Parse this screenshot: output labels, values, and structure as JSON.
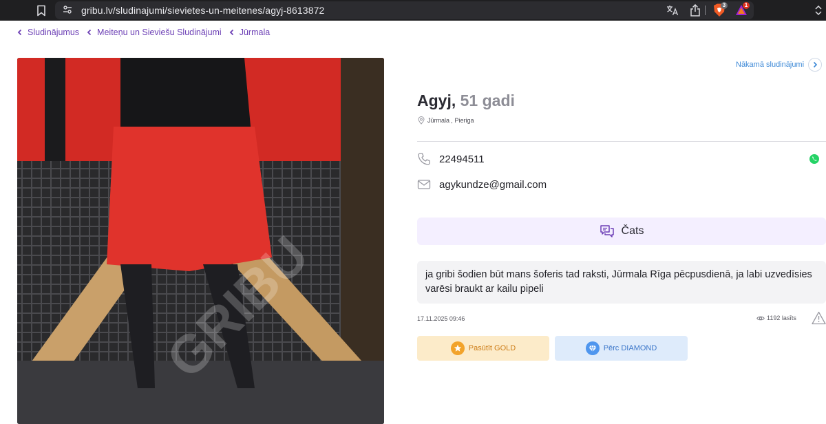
{
  "browser": {
    "url": "gribu.lv/sludinajumi/sievietes-un-meitenes/agyj-8613872",
    "shields_badge": "3",
    "rewards_badge": "1"
  },
  "breadcrumb": [
    {
      "label": "Sludinājumus"
    },
    {
      "label": "Meiteņu un Sieviešu Sludinājumi"
    },
    {
      "label": "Jūrmala"
    }
  ],
  "listing": {
    "next_label": "Nākamā sludinājumi",
    "name": "Agyj,",
    "age": "51 gadi",
    "location_city": "Jūrmala",
    "location_sep": ",",
    "location_region": "Pieriga",
    "phone": "22494511",
    "email": "agykundze@gmail.com",
    "chat_label": "Čats",
    "description": "ja gribi šodien būt mans šoferis tad raksti, Jūrmala Rīga pēcpusdienā, ja labi uzvedīsies varēsi braukt ar kailu pipeli",
    "date": "17.11.2025 09:46",
    "views": "1192 lasīts",
    "gold_label": "Pasūtīt GOLD",
    "diamond_label": "Pērc DIAMOND",
    "watermark": "GRIBU"
  },
  "colors": {
    "accent_purple": "#6c3fb5",
    "link_blue": "#3a87d6",
    "gold": "#f2a32a",
    "diamond": "#4f96ee",
    "whatsapp": "#25d366"
  },
  "icons": [
    "bookmark-icon",
    "site-settings-icon",
    "translate-icon",
    "share-icon",
    "brave-shields-icon",
    "brave-rewards-icon",
    "sidepanel-icon",
    "chevron-left-icon",
    "chevron-right-icon",
    "location-pin-icon",
    "phone-icon",
    "mail-icon",
    "whatsapp-icon",
    "chat-icon",
    "eye-icon",
    "warning-icon",
    "star-icon",
    "diamond-icon"
  ]
}
